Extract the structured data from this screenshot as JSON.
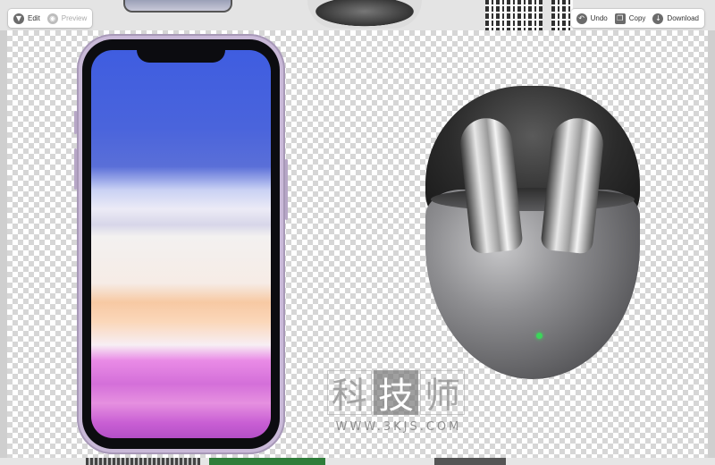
{
  "toolbar_left": {
    "edit_label": "Edit",
    "preview_label": "Preview"
  },
  "toolbar_right": {
    "undo_label": "Undo",
    "copy_label": "Copy",
    "download_label": "Download"
  },
  "watermark": {
    "chars": [
      "科",
      "技",
      "师"
    ],
    "url": "WWW.3KJS.COM"
  },
  "icons": {
    "edit": "funnel-icon",
    "preview": "eye-icon",
    "undo": "undo-icon",
    "copy": "copy-icon",
    "download": "download-icon"
  },
  "colors": {
    "led": "#3bd65a",
    "phone_frame": "#c9b9d8"
  }
}
